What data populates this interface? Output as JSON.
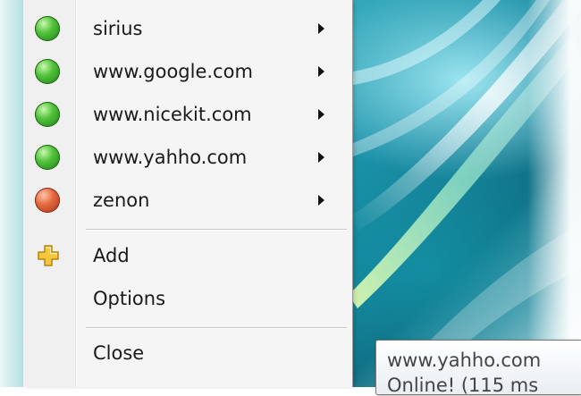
{
  "menu": {
    "hosts": [
      {
        "label": "sirius",
        "status": "online",
        "status_color": "#3fae2a",
        "icon": "green-status-icon"
      },
      {
        "label": "www.google.com",
        "status": "online",
        "status_color": "#3fae2a",
        "icon": "green-status-icon"
      },
      {
        "label": "www.nicekit.com",
        "status": "online",
        "status_color": "#3fae2a",
        "icon": "green-status-icon"
      },
      {
        "label": "www.yahho.com",
        "status": "online",
        "status_color": "#3fae2a",
        "icon": "green-status-icon"
      },
      {
        "label": "zenon",
        "status": "offline",
        "status_color": "#d9572f",
        "icon": "red-status-icon"
      }
    ],
    "add_label": "Add",
    "add_icon": "plus-icon",
    "options_label": "Options",
    "close_label": "Close"
  },
  "tooltip": {
    "line1": "www.yahho.com",
    "line2": "Online! (115 ms"
  }
}
